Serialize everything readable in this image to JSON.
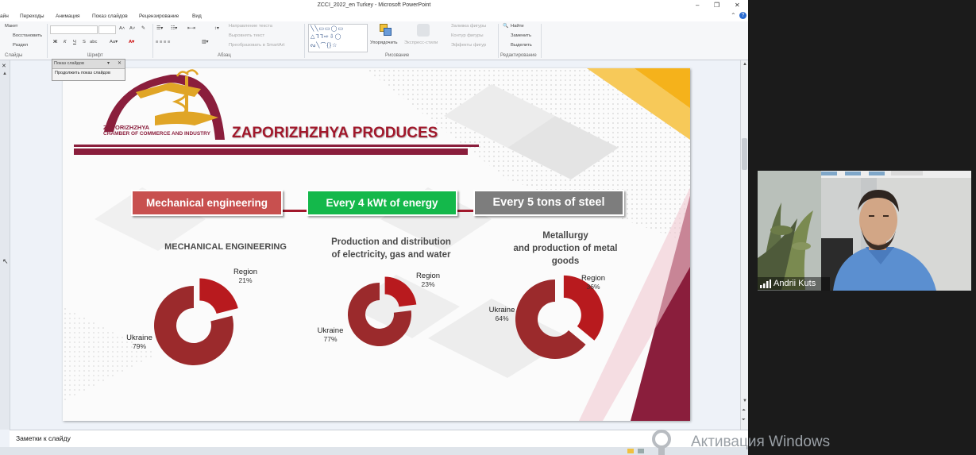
{
  "window": {
    "title": "ZCCI_2022_en Turkey - Microsoft PowerPoint",
    "controls": [
      "–",
      "❐",
      "✕"
    ]
  },
  "tabs": [
    "айн",
    "Переходы",
    "Анимация",
    "Показ слайдов",
    "Рецензирование",
    "Вид"
  ],
  "ribbon": {
    "slides_group": {
      "label": "Слайды",
      "layout": "Макет",
      "reset": "Восстановить",
      "section": "Раздел"
    },
    "font_group": {
      "label": "Шрифт",
      "bold": "Ж",
      "italic": "К",
      "underline": "Ч",
      "strike": "S",
      "shadow": "abc"
    },
    "paragraph_group": {
      "label": "Абзац",
      "text_direction": "Направление текста",
      "align_text": "Выровнять текст",
      "smartart": "Преобразовать в SmartArt"
    },
    "drawing_group": {
      "label": "Рисование",
      "arrange": "Упорядочить",
      "quick_styles": "Экспресс-стили",
      "fill": "Заливка фигуры",
      "outline": "Контур фигуры",
      "effects": "Эффекты фигур"
    },
    "editing_group": {
      "label": "Редактирование",
      "find": "Найти",
      "replace": "Заменить",
      "select": "Выделить"
    }
  },
  "popup": {
    "title": "Показ слайдов",
    "link": "Продолжить показ слайдов"
  },
  "slide": {
    "logo_line1": "ZAPORIZHZHYA",
    "logo_line2": "CHAMBER OF COMMERCE AND INDUSTRY",
    "heading": "ZAPORIZHZHYA PRODUCES",
    "boxes": [
      {
        "text": "Mechanical engineering",
        "color": "#c8504f"
      },
      {
        "text": "Every 4 kWt  of energy",
        "color": "#14b84b"
      },
      {
        "text": "Every 5 tons of steel",
        "color": "#7d7d7d"
      }
    ],
    "charts_meta": [
      {
        "title": "MECHANICAL ENGINEERING"
      },
      {
        "title": "Production and distribution\nof electricity, gas and water"
      },
      {
        "title": "Metallurgy\nand production of metal\ngoods"
      }
    ]
  },
  "chart_data": [
    {
      "type": "pie",
      "title": "MECHANICAL ENGINEERING",
      "categories": [
        "Ukraine",
        "Region"
      ],
      "values": [
        79,
        21
      ],
      "units": "%"
    },
    {
      "type": "pie",
      "title": "Production and distribution of electricity, gas and water",
      "categories": [
        "Ukraine",
        "Region"
      ],
      "values": [
        77,
        23
      ],
      "units": "%"
    },
    {
      "type": "pie",
      "title": "Metallurgy and production of metal goods",
      "categories": [
        "Ukraine",
        "Region"
      ],
      "values": [
        64,
        36
      ],
      "units": "%"
    }
  ],
  "chart_labels": [
    {
      "ukraine": "Ukraine",
      "ukraine_pct": "79%",
      "region": "Region",
      "region_pct": "21%"
    },
    {
      "ukraine": "Ukraine",
      "ukraine_pct": "77%",
      "region": "Region",
      "region_pct": "23%"
    },
    {
      "ukraine": "Ukraine",
      "ukraine_pct": "64%",
      "region": "Region",
      "region_pct": "36%"
    }
  ],
  "notes_placeholder": "Заметки к слайду",
  "webcam": {
    "participant": "Andrii Kuts"
  },
  "watermark": "Активация Windows",
  "colors": {
    "donut_main": "#9b2a2c",
    "donut_region": "#b81a1e",
    "accent_gold": "#f5b21b",
    "accent_wine": "#8a1e3c"
  }
}
